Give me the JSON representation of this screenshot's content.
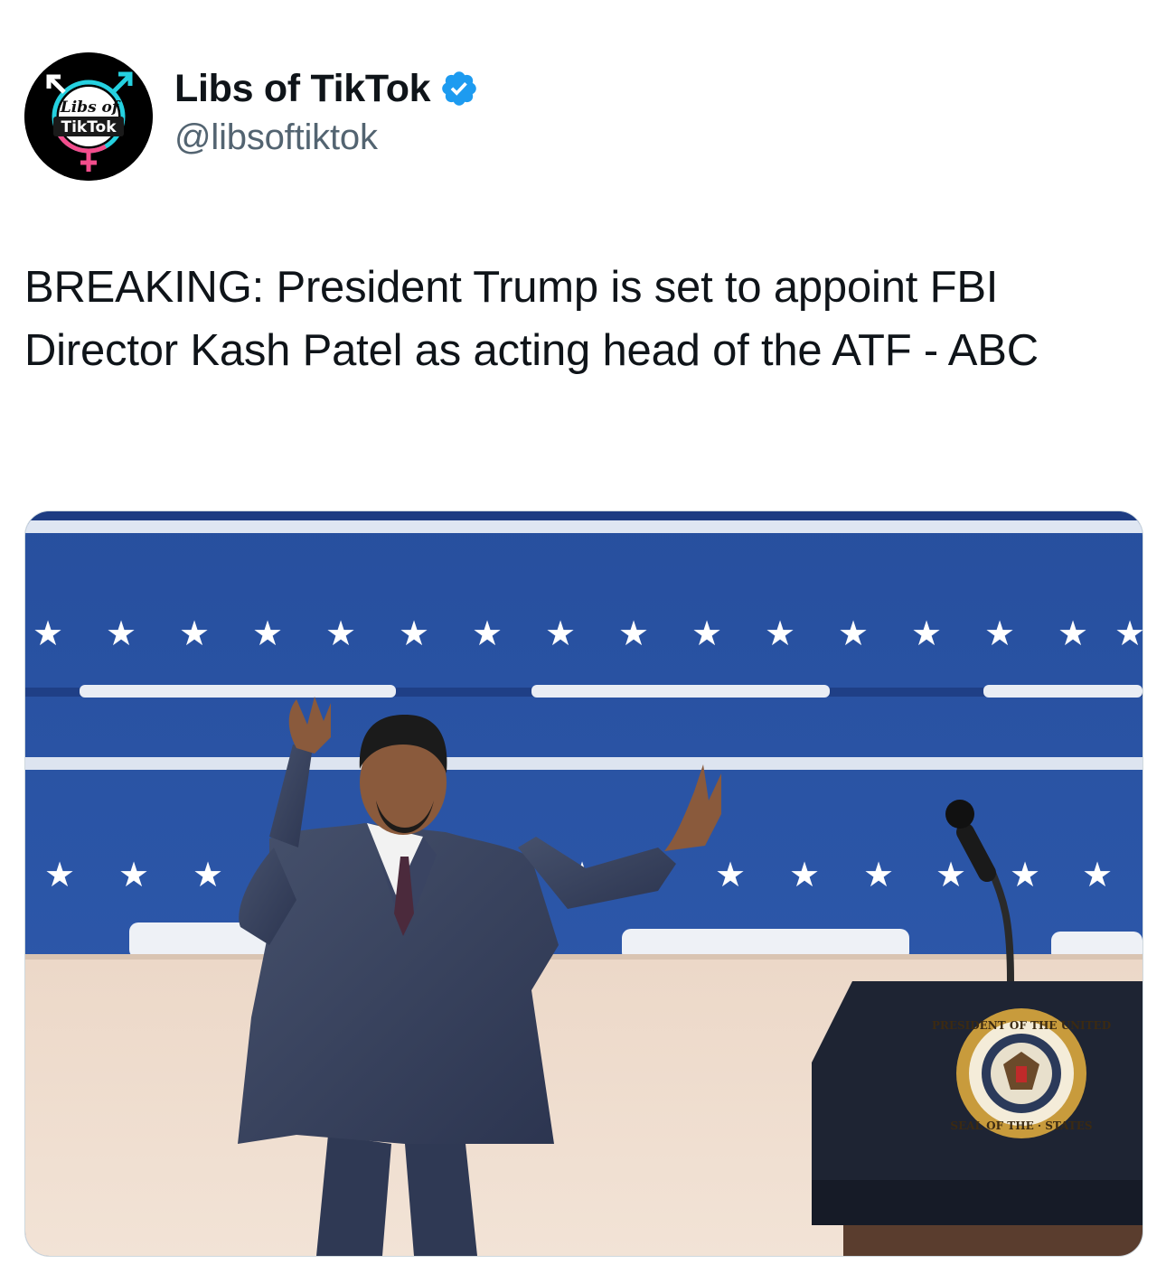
{
  "author": {
    "display_name": "Libs of TikTok",
    "handle": "@libsoftiktok",
    "verified": true,
    "verified_color": "#1d9bf0",
    "avatar": {
      "icon": "libs-of-tiktok-logo-icon",
      "line1": "Libs of",
      "line2": "TikTok"
    }
  },
  "tweet": {
    "text": "BREAKING: President Trump is set to appoint FBI Director Kash Patel as acting head of the ATF - ABC"
  },
  "media": {
    "icon": "photo-man-at-stage-icon",
    "seal_text_top": "PRESIDENT OF THE UNITED",
    "seal_text_bottom": "SEAL OF THE · STATES"
  }
}
